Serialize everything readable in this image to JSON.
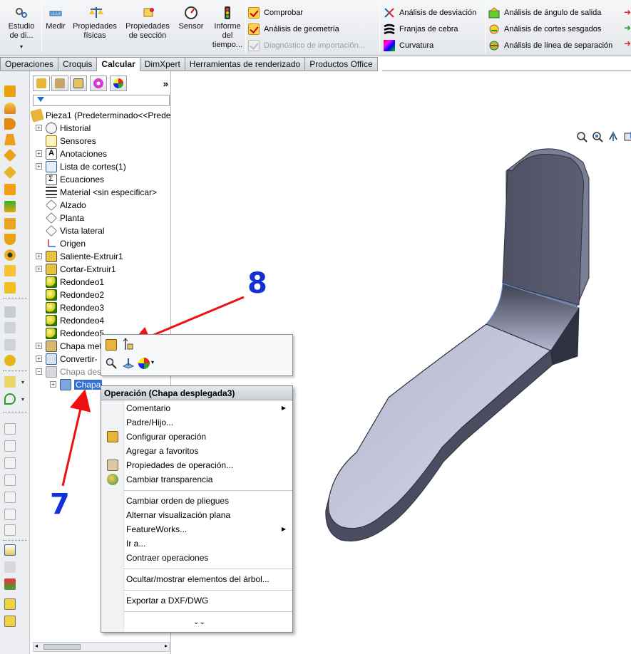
{
  "ribbon": {
    "estudio": "Estudio de di...",
    "medir": "Medir",
    "propiedades_fisicas": "Propiedades físicas",
    "propiedades_seccion": "Propiedades de sección",
    "sensor": "Sensor",
    "informe": "Informe del tiempo...",
    "comprobar": "Comprobar",
    "analisis_geometria": "Análisis de geometría",
    "diagnostico": "Diagnóstico de importación...",
    "analisis_desviacion": "Análisis de desviación",
    "franjas_cebra": "Franjas de cebra",
    "curvatura": "Curvatura",
    "angulo_salida": "Análisis de ángulo de salida",
    "cortes_sesgados": "Análisis de cortes sesgados",
    "linea_separacion": "Análisis de línea de separación"
  },
  "tabs": [
    "Operaciones",
    "Croquis",
    "Calcular",
    "DimXpert",
    "Herramientas de renderizado",
    "Productos Office"
  ],
  "active_tab": "Calcular",
  "tree": {
    "root": "Pieza1  (Predeterminado<<Prede",
    "items": [
      "Historial",
      "Sensores",
      "Anotaciones",
      "Lista de cortes(1)",
      "Ecuaciones",
      "Material <sin especificar>",
      "Alzado",
      "Planta",
      "Vista lateral",
      "Origen",
      "Saliente-Extruir1",
      "Cortar-Extruir1",
      "Redondeo1",
      "Redondeo2",
      "Redondeo3",
      "Redondeo4",
      "Redondeo5",
      "Chapa met",
      "Convertir-",
      "Chapa des",
      "Chapa"
    ],
    "selected": "Chapa"
  },
  "fm_more": "»",
  "context_menu": {
    "title": "Operación (Chapa desplegada3)",
    "items": {
      "comentario": "Comentario",
      "padre_hijo": "Padre/Hijo...",
      "configurar": "Configurar operación",
      "favoritos": "Agregar a favoritos",
      "propiedades": "Propiedades de operación...",
      "transparencia": "Cambiar transparencia",
      "orden_pliegues": "Cambiar orden de pliegues",
      "alternar_plana": "Alternar visualización plana",
      "featureworks": "FeatureWorks...",
      "ir_a": "Ir a...",
      "contraer": "Contraer operaciones",
      "ocultar": "Ocultar/mostrar elementos del árbol...",
      "exportar": "Exportar a DXF/DWG"
    },
    "submenu_arrow": "▶",
    "expand": "⌄⌄"
  },
  "annotations": {
    "a7": "7",
    "a8": "8"
  },
  "colors": {
    "annotation_blue": "#1231d6",
    "arrow_red": "#ee1111",
    "selection": "#2f6fd6",
    "model": "#c8cadf"
  }
}
